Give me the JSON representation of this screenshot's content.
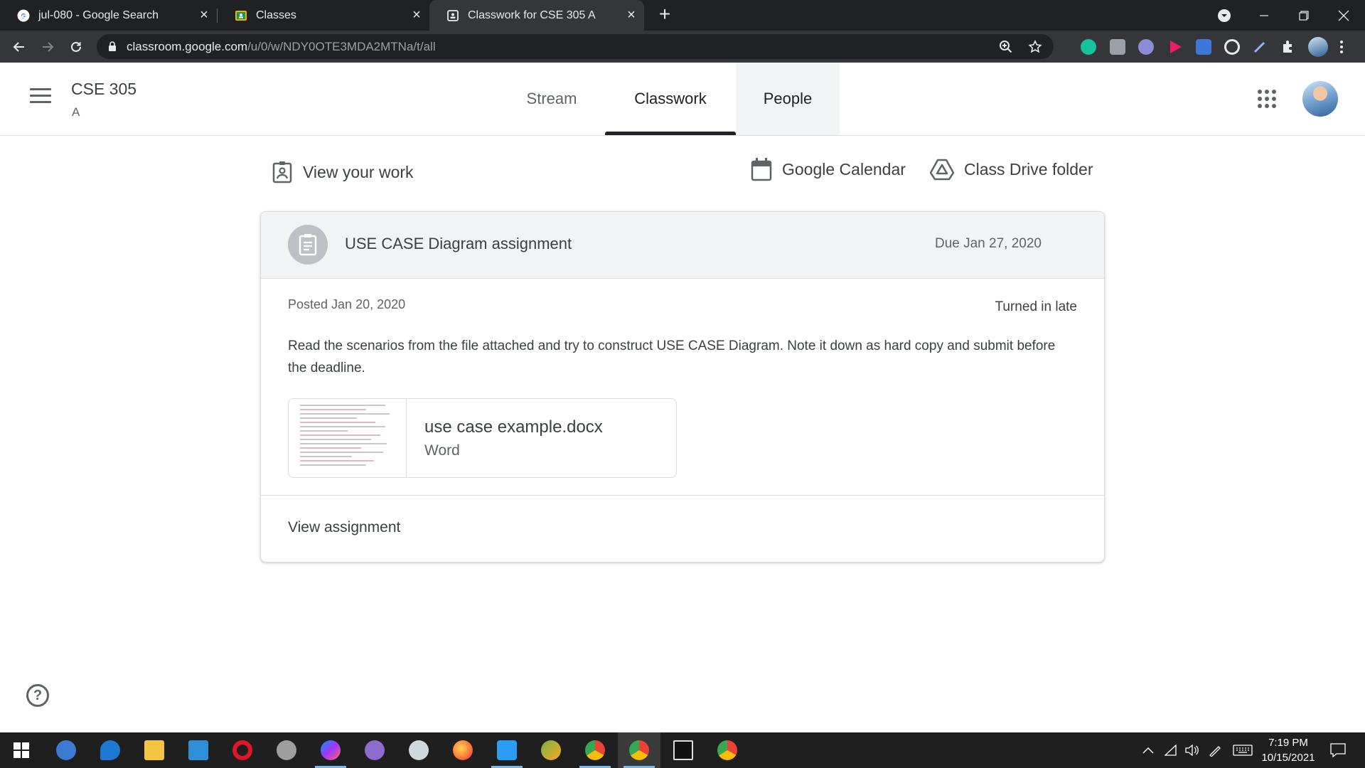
{
  "browser": {
    "tabs": [
      {
        "title": "jul-080 - Google Search",
        "favicon": "google-g-icon"
      },
      {
        "title": "Classes",
        "favicon": "classroom-icon"
      },
      {
        "title": "Classwork for CSE 305 A",
        "favicon": "classroom-icon",
        "active": true
      }
    ],
    "new_tab_label": "+",
    "url_host": "classroom.google.com",
    "url_path": "/u/0/w/NDY0OTE3MDA2MTNa/t/all"
  },
  "classroom": {
    "course_title": "CSE 305",
    "course_section": "A",
    "nav_tabs": [
      "Stream",
      "Classwork",
      "People"
    ],
    "selected_tab": "Classwork"
  },
  "actions": {
    "view_work": "View your work",
    "calendar": "Google Calendar",
    "drive": "Class Drive folder"
  },
  "assignment": {
    "title": "USE CASE Diagram assignment",
    "due": "Due Jan 27, 2020",
    "posted": "Posted Jan 20, 2020",
    "status": "Turned in late",
    "description": "Read the scenarios from the file attached and try to construct USE CASE Diagram. Note it down as hard copy and submit before the deadline.",
    "attachment": {
      "name": "use case example.docx",
      "type": "Word"
    },
    "view_label": "View assignment"
  },
  "help_label": "?",
  "taskbar": {
    "time": "7:19 PM",
    "date": "10/15/2021"
  }
}
